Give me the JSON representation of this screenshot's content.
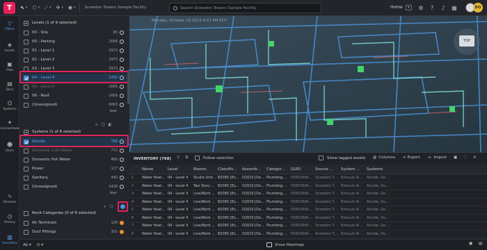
{
  "app": {
    "logo_letter": "T",
    "facility": "Snowdon Towers Sample Facility",
    "search_placeholder": "Search Snowdon Towers Sample Facility",
    "home_label": "Home",
    "avatar_initials": "DO"
  },
  "rail": [
    {
      "label": "Filters",
      "icon": "filter-icon",
      "active": true
    },
    {
      "label": "Assets",
      "icon": "tag-icon"
    },
    {
      "label": "Files",
      "icon": "image-icon"
    },
    {
      "label": "Docs",
      "icon": "document-icon"
    },
    {
      "label": "Systems",
      "icon": "nodes-icon"
    },
    {
      "label": "Connections",
      "icon": "connections-icon"
    },
    {
      "label": "Users",
      "icon": "users-icon"
    },
    {
      "label": "Streams",
      "icon": "streams-icon"
    },
    {
      "label": "History",
      "icon": "history-icon"
    },
    {
      "label": "Inventory",
      "icon": "inventory-icon",
      "active": true
    }
  ],
  "levels": {
    "title": "Levels (1 of 9 selected)",
    "items": [
      {
        "label": "00 - Site",
        "count": "80"
      },
      {
        "label": "00 - Parking",
        "count": "2658"
      },
      {
        "label": "01 - Level 1",
        "count": "2973"
      },
      {
        "label": "02 - Level 2",
        "count": "2973"
      },
      {
        "label": "03 - Level 3",
        "count": "2973"
      },
      {
        "label": "04 - Level 4",
        "count": "1493",
        "selected": true
      },
      {
        "label": "05 - Level 5",
        "count": "2665"
      },
      {
        "label": "06 - Roof",
        "count": "1669"
      },
      {
        "label": "(Unassigned)",
        "count": "6063"
      }
    ],
    "less": "less"
  },
  "systems": {
    "title": "Systems (1 of 6 selected)",
    "items": [
      {
        "label": "Airside",
        "count": "768",
        "selected": true
      },
      {
        "label": "Domestic Cold Water",
        "count": "772"
      },
      {
        "label": "Domestic Hot Water",
        "count": "480"
      },
      {
        "label": "Power",
        "count": "127"
      },
      {
        "label": "Sanitary",
        "count": "440"
      },
      {
        "label": "(Unassigned)",
        "count": "2428"
      }
    ],
    "less": "less"
  },
  "revit": {
    "title": "Revit Categories (0 of 6 selected)",
    "items": [
      {
        "label": "Air Terminals",
        "count": "128"
      },
      {
        "label": "Duct Fittings",
        "count": "302"
      }
    ]
  },
  "viewport": {
    "date_text": "Monday, October 16 2023 4:57 PM EDT",
    "navcube_label": "TOP"
  },
  "inventory": {
    "title": "INVENTORY (768)",
    "follow_label": "Follow selection",
    "tagged_label": "Show tagged assets",
    "columns_label": "Columns",
    "export_label": "Export",
    "import_label": "Import",
    "headers": [
      "",
      "Name",
      "Level",
      "Rooms",
      "Classific...",
      "Assemb...",
      "Categor...",
      "GUID",
      "Source ...",
      "System ...",
      "Systems"
    ],
    "rows": [
      [
        "1",
        "Water Heat...",
        "04 - Level 4",
        "Studio Unit...",
        "B2095 [Ex...",
        "D2010 [Do...",
        "Plumbing ...",
        "558209d0-...",
        "Snowdon T...",
        "Exhaust Ai...",
        "Airside, Do..."
      ],
      [
        "2",
        "Water Heat...",
        "04 - Level 4",
        "Two Story ...",
        "B2095 [Ex...",
        "D2010 [Do...",
        "Plumbing ...",
        "558209d0-...",
        "Snowdon T...",
        "Exhaust Ai...",
        "Airside, Do..."
      ],
      [
        "3",
        "Water Heat...",
        "04 - Level 4",
        "Live/Work ...",
        "B2095 [Ex...",
        "D2010 [Do...",
        "Plumbing ...",
        "558209d0-...",
        "Snowdon T...",
        "Exhaust Ai...",
        "Airside, Do..."
      ],
      [
        "4",
        "Water Heat...",
        "04 - Level 4",
        "Live/Work ...",
        "B2095 [Ex...",
        "D2010 [Do...",
        "Plumbing ...",
        "558209d0-...",
        "Snowdon T...",
        "Exhaust Ai...",
        "Airside, Do..."
      ],
      [
        "5",
        "Water Heat...",
        "04 - Level 4",
        "Live/Work ...",
        "B2095 [Ex...",
        "D2010 [Do...",
        "Plumbing ...",
        "558209d0-...",
        "Snowdon T...",
        "Exhaust Ai...",
        "Airside, Do..."
      ],
      [
        "6",
        "Water Heat...",
        "04 - Level 4",
        "Live/Work ...",
        "B2095 [Ex...",
        "D2010 [Do...",
        "Plumbing ...",
        "558209d0-...",
        "Snowdon T...",
        "Exhaust Ai...",
        "Airside, Do..."
      ],
      [
        "7",
        "Water Heat...",
        "04 - Level 4",
        "Live/Work ...",
        "B2095 [Ex...",
        "D2010 [Do...",
        "Plumbing ...",
        "558209d0-...",
        "Snowdon T...",
        "Exhaust Ai...",
        "Airside, Do..."
      ],
      [
        "8",
        "Water Heat...",
        "04 - Level 4",
        "Live/Work ...",
        "B2095 [Ex...",
        "D2010 [Do...",
        "Plumbing ...",
        "558209d0-...",
        "Snowdon T...",
        "Exhaust Ai...",
        "Airside, Do..."
      ]
    ]
  },
  "bottom": {
    "heatmap_label": "Show Heatmap"
  },
  "colors": {
    "accent": "#e8205a",
    "selection": "#5aa8ff",
    "highlight_box": "#e0245e"
  }
}
